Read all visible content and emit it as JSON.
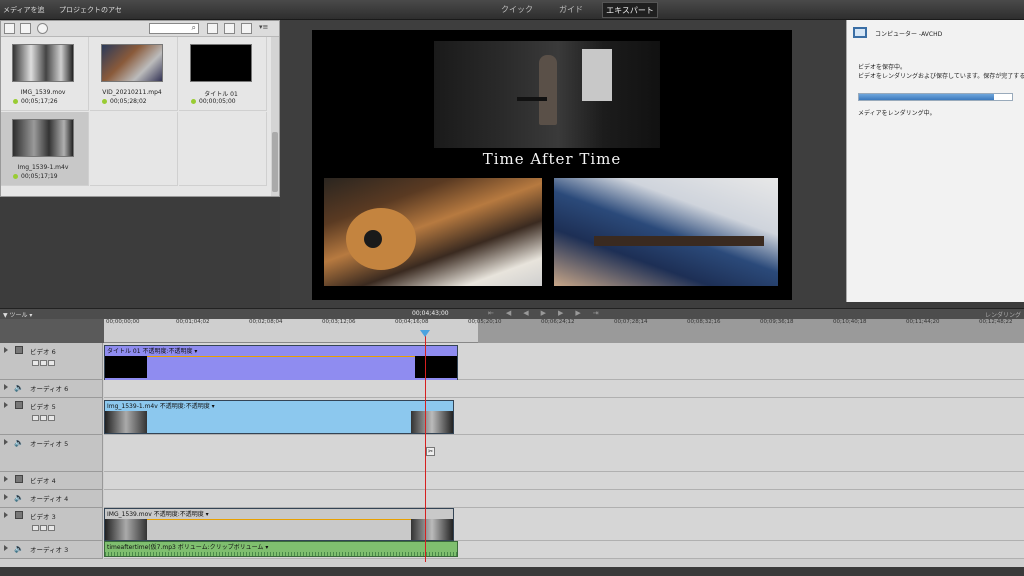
{
  "topbar": {
    "add_media": "メディアを追加",
    "project_assets": "プロジェクトのアセット",
    "modes": [
      "クイック",
      "ガイド",
      "エキスパート"
    ]
  },
  "assets": {
    "items": [
      {
        "name": "IMG_1539.mov",
        "duration": "00;05;17;26"
      },
      {
        "name": "VID_20210211.mp4",
        "duration": "00;05;28;02"
      },
      {
        "name": "タイトル 01",
        "duration": "00;00;05;00"
      },
      {
        "name": "Img_1539-1.m4v",
        "duration": "00;05;17;19"
      }
    ]
  },
  "preview": {
    "title_text": "Time After Time"
  },
  "right_panel": {
    "device": "コンピューター -AVCHD",
    "line1": "ビデオを保存中。",
    "line2": "ビデオをレンダリングおよび保存しています。保存が完了する",
    "status": "メディアをレンダリング中。",
    "progress_fraction": 0.88
  },
  "timeline": {
    "current_time": "00;04;43;00",
    "render_label": "レンダリング",
    "ticks": [
      "00;00;00;00",
      "00;01;04;02",
      "00;02;08;04",
      "00;03;12;06",
      "00;04;16;08",
      "00;05;20;10",
      "00;06;24;12",
      "00;07;28;14",
      "00;08;32;16",
      "00;09;36;18",
      "00;10;40;18",
      "00;11;44;20",
      "00;12;48;22"
    ],
    "tracks": {
      "v6": "ビデオ 6",
      "a6": "オーディオ 6",
      "v5": "ビデオ 5",
      "a5": "オーディオ 5",
      "v4": "ビデオ 4",
      "a4": "オーディオ 4",
      "v3": "ビデオ 3",
      "a3": "オーディオ 3"
    },
    "clips": {
      "title": "タイトル 01 不透明度:不透明度 ▾",
      "img1539m4v": "Img_1539-1.m4v 不透明度:不透明度 ▾",
      "img1539mov": "IMG_1539.mov 不透明度:不透明度 ▾",
      "audio": "timeaftertime(仮7.mp3 ボリューム:クリップボリューム ▾"
    }
  },
  "colors": {
    "title_clip": "#8f8cf0",
    "video_clip": "#8cc8ee",
    "audio_clip": "#7fbf6f",
    "playhead": "#d62020"
  }
}
